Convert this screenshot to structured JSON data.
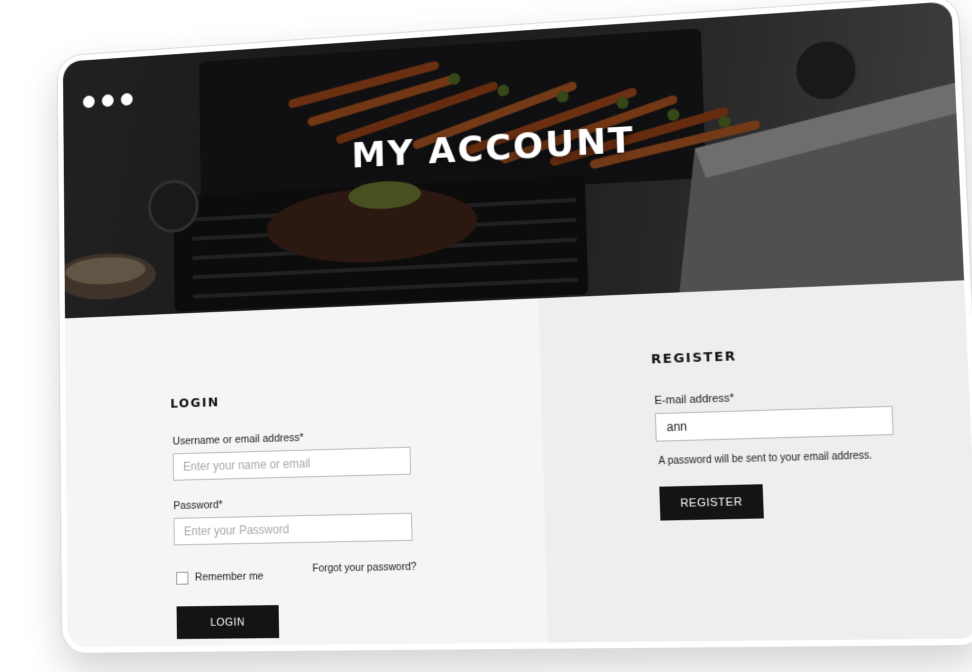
{
  "window": {
    "dots": [
      "window-dot",
      "window-dot",
      "window-dot"
    ]
  },
  "hero": {
    "title": "MY ACCOUNT"
  },
  "login": {
    "title": "LOGIN",
    "username_label": "Username or email address*",
    "username_placeholder": "Enter your name or email",
    "password_label": "Password*",
    "password_placeholder": "Enter your Password",
    "remember_label": "Remember me",
    "forgot_label": "Forgot your password?",
    "submit_label": "LOGIN"
  },
  "register": {
    "title": "REGISTER",
    "email_label": "E-mail address*",
    "email_value": "ann",
    "note": "A password will be sent to your email address.",
    "submit_label": "REGISTER"
  },
  "colors": {
    "button": "#141414",
    "panel_left": "#f5f5f6",
    "panel_right": "#eeeef0"
  }
}
